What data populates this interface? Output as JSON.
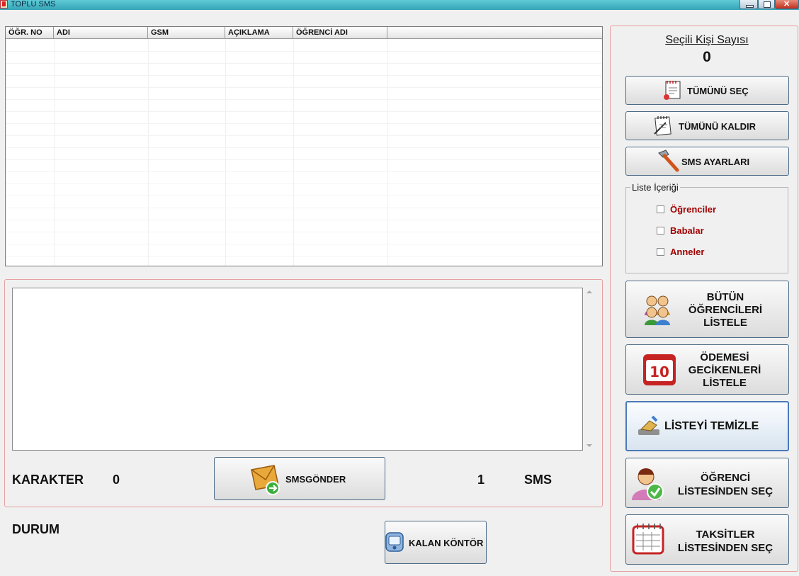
{
  "window": {
    "title": "TOPLU SMS"
  },
  "grid": {
    "columns": [
      "ÖĞR. NO",
      "ADI",
      "GSM",
      "AÇIKLAMA",
      "ÖĞRENCİ ADI",
      ""
    ]
  },
  "message": {
    "text": "",
    "karakter_label": "KARAKTER",
    "karakter_value": "0",
    "sms_count": "1",
    "sms_label": "SMS",
    "send_label": "SMSGÖNDER"
  },
  "status": {
    "durum_label": "DURUM"
  },
  "kontor": {
    "label": "KALAN KÖNTÖR"
  },
  "right": {
    "selected_header": "Seçili Kişi Sayısı",
    "selected_count": "0",
    "select_all": "TÜMÜNÜ SEÇ",
    "deselect_all": "TÜMÜNÜ KALDIR",
    "sms_settings": "SMS AYARLARI",
    "list_group_title": "Liste İçeriği",
    "checkboxes": [
      {
        "label": "Öğrenciler",
        "checked": false
      },
      {
        "label": "Babalar",
        "checked": false
      },
      {
        "label": "Anneler",
        "checked": false
      }
    ],
    "list_all_students": [
      "BÜTÜN",
      "ÖĞRENCİLERİ",
      "LİSTELE"
    ],
    "list_overdue": [
      "ÖDEMESİ",
      "GECİKENLERİ",
      "LİSTELE"
    ],
    "overdue_icon_number": "10",
    "clear_list": "LİSTEYİ TEMİZLE",
    "select_from_students": [
      "ÖĞRENCİ",
      "LİSTESİNDEN SEÇ"
    ],
    "select_from_installments": [
      "TAKSİTLER",
      "LİSTESİNDEN SEÇ"
    ]
  },
  "colors": {
    "accent": "#4c6a86",
    "checkbox_label": "#a00000",
    "frame": "#e8a0a0"
  }
}
